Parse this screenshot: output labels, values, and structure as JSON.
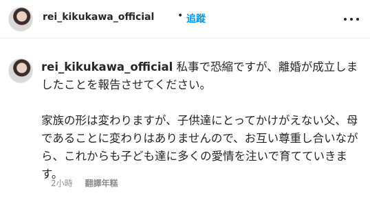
{
  "post": {
    "username": "rei_kikukawa_official",
    "separator": "•",
    "follow_label": "追蹤",
    "more_icon": "more-options-icon"
  },
  "caption": {
    "username": "rei_kikukawa_official",
    "paragraph1": "私事で恐縮ですが、離婚が成立しましたことを報告させてください。",
    "paragraph2": "家族の形は変わりますが、子供達にとってかけがえない父、母であることに変わりはありませんので、お互い尊重し合いながら、これからも子ども達に多くの愛情を注いで育てていきます。",
    "timestamp": "2小時",
    "translate_label": "翻譯年糕"
  },
  "colors": {
    "accent": "#0095f6",
    "text": "#262626",
    "muted": "#8e8e8e"
  }
}
